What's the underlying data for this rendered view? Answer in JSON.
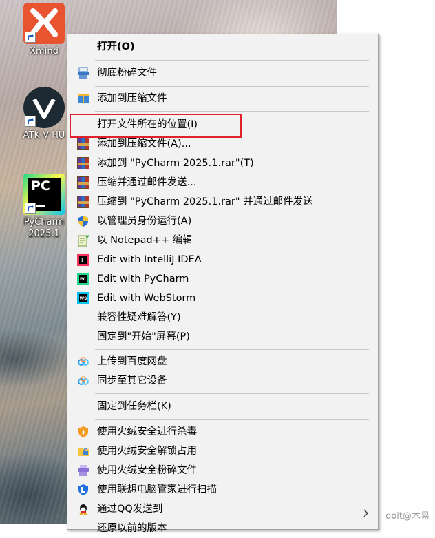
{
  "desktop": {
    "icons": [
      {
        "label": "Xmind"
      },
      {
        "label": "ATK V HU"
      },
      {
        "label_line1": "PyCharm",
        "label_line2": "2025.1"
      }
    ]
  },
  "context_menu": {
    "items": [
      {
        "label": "打开(O)",
        "icon": "none",
        "bold": true
      },
      {
        "label": "彻底粉碎文件",
        "icon": "shredder-icon"
      },
      {
        "label": "添加到压缩文件",
        "icon": "archive-icon"
      },
      {
        "label": "打开文件所在的位置(I)",
        "icon": "none",
        "highlighted": true
      },
      {
        "label": "添加到压缩文件(A)...",
        "icon": "winrar-icon"
      },
      {
        "label": "添加到 \"PyCharm 2025.1.rar\"(T)",
        "icon": "winrar-icon"
      },
      {
        "label": "压缩并通过邮件发送...",
        "icon": "winrar-icon"
      },
      {
        "label": "压缩到 \"PyCharm 2025.1.rar\" 并通过邮件发送",
        "icon": "winrar-icon"
      },
      {
        "label": "以管理员身份运行(A)",
        "icon": "uac-shield-icon"
      },
      {
        "label": "以 Notepad++ 编辑",
        "icon": "notepadpp-icon"
      },
      {
        "label": "Edit with IntelliJ IDEA",
        "icon": "intellij-icon"
      },
      {
        "label": "Edit with PyCharm",
        "icon": "pycharm-icon"
      },
      {
        "label": "Edit with WebStorm",
        "icon": "webstorm-icon"
      },
      {
        "label": "兼容性疑难解答(Y)",
        "icon": "none"
      },
      {
        "label": "固定到\"开始\"屏幕(P)",
        "icon": "none"
      },
      {
        "label": "上传到百度网盘",
        "icon": "baidu-netdisk-icon"
      },
      {
        "label": "同步至其它设备",
        "icon": "baidu-netdisk-icon"
      },
      {
        "label": "固定到任务栏(K)",
        "icon": "none"
      },
      {
        "label": "使用火绒安全进行杀毒",
        "icon": "huorong-icon"
      },
      {
        "label": "使用火绒安全解锁占用",
        "icon": "folder-unlock-icon"
      },
      {
        "label": "使用火绒安全粉碎文件",
        "icon": "shredder-purple-icon"
      },
      {
        "label": "使用联想电脑管家进行扫描",
        "icon": "lenovo-icon"
      },
      {
        "label": "通过QQ发送到",
        "icon": "qq-icon",
        "has_submenu": true
      },
      {
        "label": "还原以前的版本",
        "icon": "none"
      }
    ]
  },
  "colors": {
    "menu_bg": "#f2f2f2",
    "highlight_border": "#e0222d",
    "separator": "#c9c9c9"
  },
  "watermark": "doit@木易"
}
